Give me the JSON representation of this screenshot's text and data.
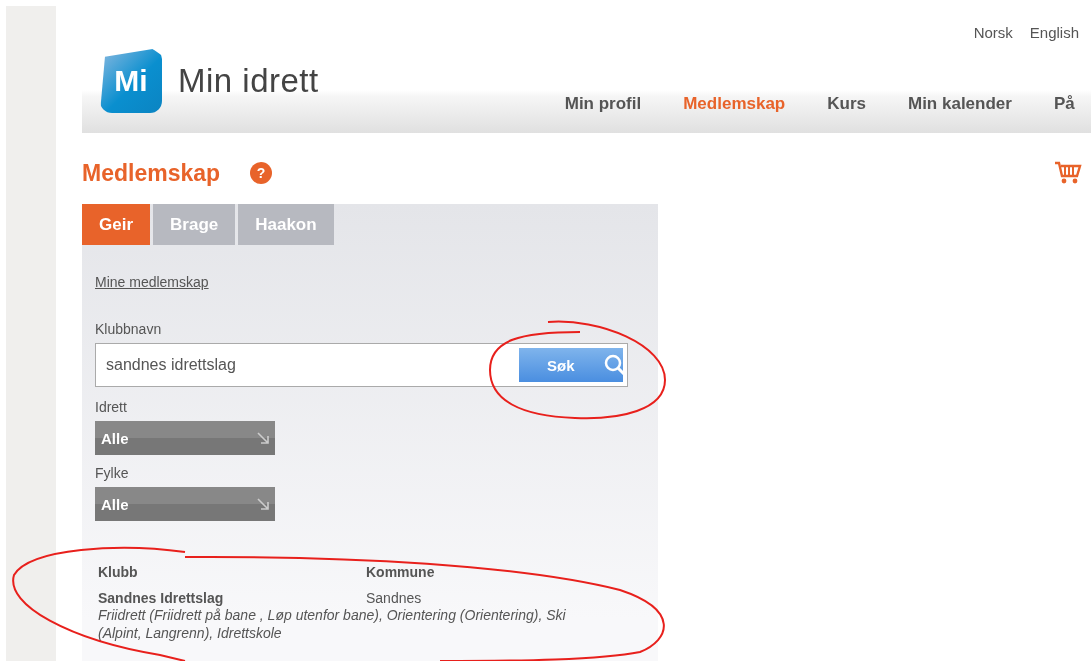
{
  "languages": [
    {
      "label": "Norsk"
    },
    {
      "label": "English"
    }
  ],
  "logo": {
    "mark": "Mi",
    "name": "Min idrett"
  },
  "nav": [
    {
      "label": "Min profil",
      "selected": false
    },
    {
      "label": "Medlemskap",
      "selected": true
    },
    {
      "label": "Kurs",
      "selected": false
    },
    {
      "label": "Min kalender",
      "selected": false
    },
    {
      "label": "På",
      "selected": false
    }
  ],
  "page_title": "Medlemskap",
  "help": "?",
  "tabs": [
    {
      "label": "Geir",
      "selected": true
    },
    {
      "label": "Brage",
      "selected": false
    },
    {
      "label": "Haakon",
      "selected": false
    }
  ],
  "link": "Mine medlemskap",
  "club_field": {
    "label": "Klubbnavn",
    "value": "sandnes idrettslag",
    "button": "Søk"
  },
  "filters": [
    {
      "label": "Idrett",
      "value": "Alle"
    },
    {
      "label": "Fylke",
      "value": "Alle"
    }
  ],
  "results": {
    "columns": [
      "Klubb",
      "Kommune"
    ],
    "rows": [
      {
        "club": "Sandnes Idrettslag",
        "municipality": "Sandnes",
        "sports": "Friidrett (Friidrett på bane , Løp utenfor bane), Orientering (Orientering), Ski (Alpint, Langrenn), Idrettskole"
      }
    ]
  }
}
